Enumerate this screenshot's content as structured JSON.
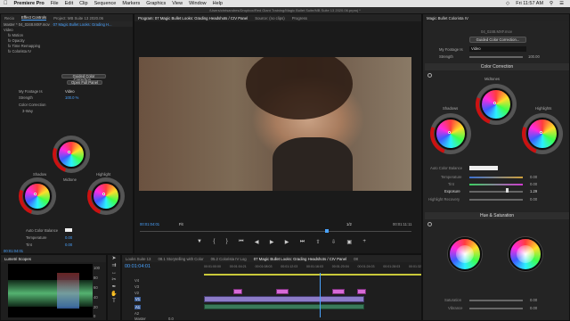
{
  "menubar": {
    "apple": "",
    "app": "Premiere Pro",
    "items": [
      "File",
      "Edit",
      "Clip",
      "Sequence",
      "Markers",
      "Graphics",
      "View",
      "Window",
      "Help"
    ],
    "status": "Fri 11:57 AM"
  },
  "titlebar": "/Users/chrisandres/Dropbox/Red Giant Training/Magic Bullet Suite/MB Suite 13 2020.06.prproj *",
  "left_tabs": [
    "Recio",
    "Effect Controls",
    "Project: MB Suite 13 2020.06"
  ],
  "effect_controls": {
    "master": "Master * 04_0248.MXF.mov",
    "seq": "07 Magic Bullet Looks: Grading H...",
    "rows": [
      "Video",
      "Motion",
      "Opacity",
      "Time Remapping",
      "Colorista IV"
    ],
    "btn_guided": "Guided Color Correction...",
    "btn_open": "Open Full Panel",
    "footage_label": "My Footage Is",
    "footage_value": "Video",
    "strength_label": "Strength",
    "strength_value": "100.0 %",
    "colorcorr_label": "Color Correction",
    "way_label": "3-Way",
    "shadow": "Shadow",
    "midtone": "Midtone",
    "highlight": "Highlight",
    "acb_label": "Auto Color Balance",
    "temp_label": "Temperature",
    "temp_value": "0.00",
    "tint_label": "Tint",
    "tint_value": "0.00",
    "timecode": "00:01:04:01"
  },
  "program": {
    "tabs": [
      "Program: 07 Magic Bullet Looks: Grading Headshots / CIV Panel",
      "Source: (no clips)",
      "Progress"
    ],
    "timecode": "00:01:04:01",
    "fit": "Fit",
    "ratio": "1/2",
    "duration": "00:01:11:11"
  },
  "right": {
    "title": "Magic Bullet Colorista IV",
    "clip_name": "04_0248.MXF.mov",
    "guided_btn": "Guided Color Correction...",
    "footage_label": "My Footage Is",
    "footage_value": "Video",
    "strength_label": "Strength",
    "strength_value": "100.00",
    "cc_header": "Color Correction",
    "midtones": "Midtones",
    "shadows": "Shadows",
    "highlights": "Highlights",
    "acb_label": "Auto Color Balance",
    "temperature_label": "Temperature",
    "temperature_value": "0.00",
    "tint_label": "Tint",
    "tint_value": "0.00",
    "exposure_label": "Exposure",
    "exposure_value": "1.29",
    "hr_label": "Highlight Recovery",
    "hr_value": "0.00",
    "hs_header": "Hue & Saturation",
    "sat_label": "Saturation",
    "sat_value": "0.00",
    "vib_label": "Vibrance",
    "vib_value": "0.00"
  },
  "lumetri": {
    "title": "Lumetri Scopes",
    "scale": [
      "100",
      "80",
      "60",
      "40",
      "20",
      "0"
    ]
  },
  "timeline": {
    "tabs": [
      "Looks Suite 13",
      "08.1 Storytelling with Color",
      "05.2 Colorista IV Log",
      "07 Magic Bullet Looks: Grading Headshots / CIV Panel",
      "08"
    ],
    "timecode": "00:01:04:01",
    "ruler": [
      "00:01:00:00",
      "00:01:04:21",
      "00:01:08:03",
      "00:01:12:03",
      "00:01:16:03",
      "00:01:20:04",
      "00:01:24:03",
      "00:01:28:03",
      "00:01:32"
    ],
    "tracks": [
      "V4",
      "V3",
      "V2",
      "V1",
      "A1",
      "A2",
      "Master"
    ],
    "master_value": "0.0"
  }
}
